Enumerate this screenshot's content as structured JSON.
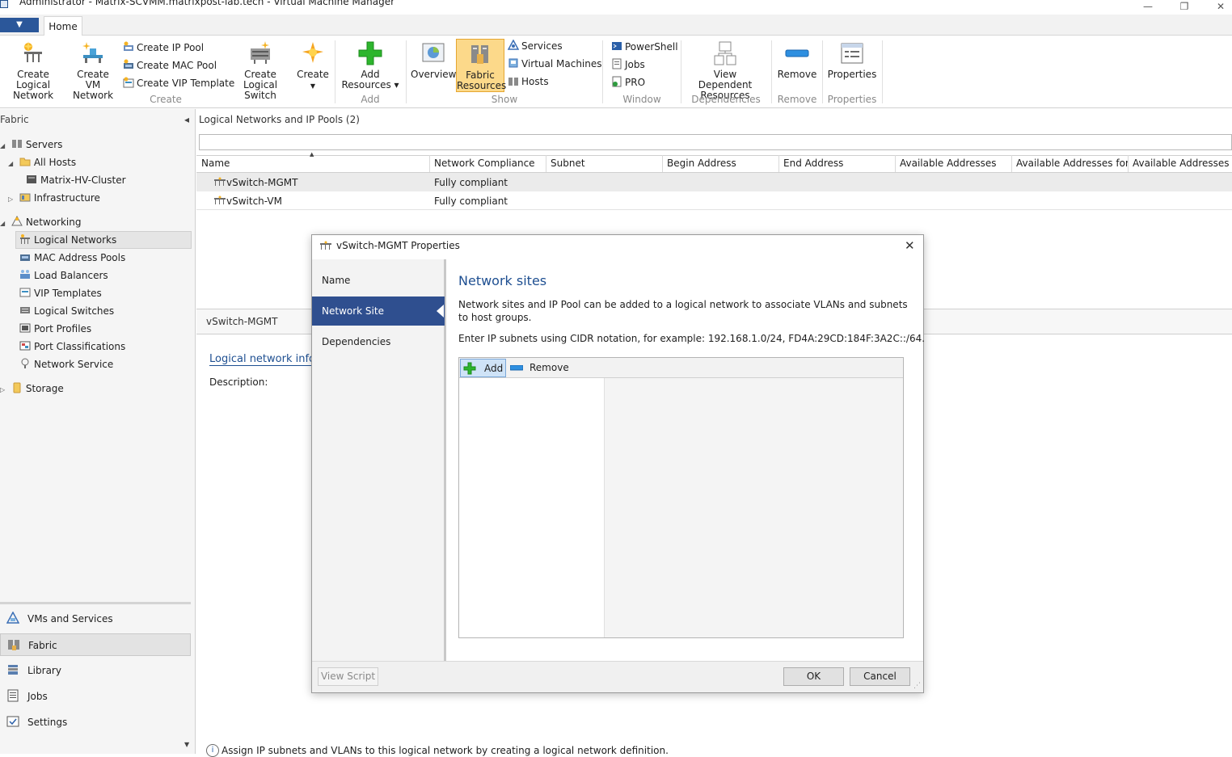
{
  "window": {
    "title": "Administrator - Matrix-SCVMM.matrixpost-lab.tech - Virtual Machine Manager",
    "minimize": "—",
    "restore": "❐",
    "close": "✕"
  },
  "tabs": {
    "file": "▼",
    "home": "Home"
  },
  "ribbon": {
    "create_group": {
      "label": "Create",
      "create_logical_network": "Create Logical Network",
      "create_vm_network": "Create VM Network",
      "create_ip_pool": "Create IP Pool",
      "create_mac_pool": "Create MAC Pool",
      "create_vip_template": "Create VIP Template",
      "create_logical_switch": "Create Logical Switch",
      "create": "Create"
    },
    "add_group": {
      "label": "Add",
      "add_resources": "Add Resources ▾"
    },
    "show_group": {
      "label": "Show",
      "overview": "Overview",
      "fabric_resources": "Fabric Resources",
      "services": "Services",
      "virtual_machines": "Virtual Machines",
      "hosts": "Hosts"
    },
    "window_group": {
      "label": "Window",
      "powershell": "PowerShell",
      "jobs": "Jobs",
      "pro": "PRO"
    },
    "dependencies_group": {
      "label": "Dependencies",
      "view_dependent": "View Dependent Resources"
    },
    "remove_group": {
      "label": "Remove",
      "remove": "Remove"
    },
    "properties_group": {
      "label": "Properties",
      "properties": "Properties"
    }
  },
  "sidebar": {
    "header": "Fabric",
    "collapse": "◂",
    "tree": {
      "servers": "Servers",
      "all_hosts": "All Hosts",
      "cluster": "Matrix-HV-Cluster",
      "infrastructure": "Infrastructure",
      "networking": "Networking",
      "logical_networks": "Logical Networks",
      "mac_pools": "MAC Address Pools",
      "load_balancers": "Load Balancers",
      "vip_templates": "VIP Templates",
      "logical_switches": "Logical Switches",
      "port_profiles": "Port Profiles",
      "port_classifications": "Port Classifications",
      "network_service": "Network Service",
      "storage": "Storage"
    },
    "nav": {
      "vms_services": "VMs and Services",
      "fabric": "Fabric",
      "library": "Library",
      "jobs": "Jobs",
      "settings": "Settings"
    }
  },
  "main": {
    "header": "Logical Networks and IP Pools (2)",
    "search_placeholder": "",
    "columns": [
      "Name",
      "Network Compliance",
      "Subnet",
      "Begin Address",
      "End Address",
      "Available Addresses",
      "Available Addresses for...",
      "Available Addresses for"
    ],
    "rows": [
      {
        "name": "vSwitch-MGMT",
        "compliance": "Fully compliant"
      },
      {
        "name": "vSwitch-VM",
        "compliance": "Fully compliant"
      }
    ],
    "details_title": "vSwitch-MGMT",
    "details_link": "Logical network inforr",
    "description_label": "Description:",
    "footer_note": "Assign IP subnets and VLANs to this logical network by creating a logical network definition."
  },
  "dialog": {
    "title": "vSwitch-MGMT Properties",
    "close": "✕",
    "nav": [
      "Name",
      "Network Site",
      "Dependencies"
    ],
    "heading": "Network sites",
    "desc1": "Network sites and IP Pool can be added to a logical network to associate VLANs and subnets to host groups.",
    "desc2": "Enter IP subnets using CIDR notation, for example: 192.168.1.0/24, FD4A:29CD:184F:3A2C::/64.",
    "add": "Add",
    "remove": "Remove",
    "view_script": "View Script",
    "ok": "OK",
    "cancel": "Cancel"
  },
  "colors": {
    "accent": "#2b579a",
    "nav_active": "#2f4f8f",
    "link": "#1e4f91",
    "selected_fill": "#fcd98a"
  }
}
